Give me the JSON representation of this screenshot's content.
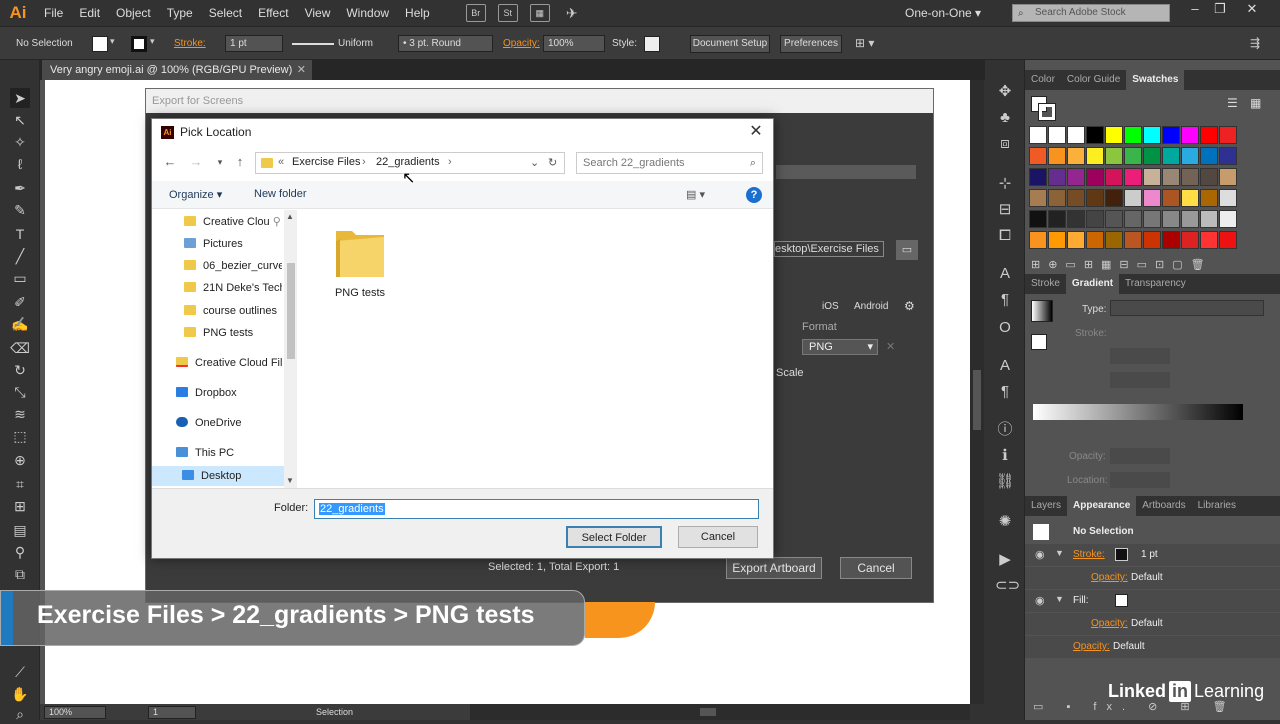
{
  "menu": {
    "logo": "Ai",
    "items": [
      "File",
      "Edit",
      "Object",
      "Type",
      "Select",
      "Effect",
      "View",
      "Window",
      "Help"
    ],
    "bridge_label": "Br",
    "stock_label": "St",
    "workspace": "One-on-One",
    "stock_search_placeholder": "Search Adobe Stock"
  },
  "control_bar": {
    "selection": "No Selection",
    "stroke_label": "Stroke:",
    "stroke_value": "1 pt",
    "profile": "Uniform",
    "brush": "3 pt. Round",
    "opacity_label": "Opacity:",
    "opacity_value": "100%",
    "style_label": "Style:",
    "document_setup": "Document Setup",
    "preferences": "Preferences"
  },
  "document": {
    "tab_title": "Very angry emoji.ai @ 100% (RGB/GPU Preview)"
  },
  "status_bar": {
    "zoom": "100%",
    "artboard": "1",
    "mode": "Selection"
  },
  "panels": {
    "top_tabs": [
      "Color",
      "Color Guide",
      "Swatches"
    ],
    "mid_tabs": [
      "Stroke",
      "Gradient",
      "Transparency"
    ],
    "gradient_type_label": "Type:",
    "gradient_stroke_label": "Stroke:",
    "opacity_label": "Opacity:",
    "location_label": "Location:",
    "bottom_tabs": [
      "Layers",
      "Appearance",
      "Artboards",
      "Libraries"
    ],
    "appearance": {
      "title": "No Selection",
      "stroke_label": "Stroke:",
      "stroke_value": "1 pt",
      "opacity_label": "Opacity:",
      "opacity_value": "Default",
      "fill_label": "Fill:",
      "fill_opacity_value": "Default",
      "global_opacity_value": "Default"
    }
  },
  "export_dialog": {
    "title": "Export for Screens",
    "path_fragment": "esktop\\Exercise Files",
    "ios_label": "iOS",
    "android_label": "Android",
    "format_header": "Format",
    "format_value": "PNG",
    "scale_label": "Scale",
    "summary": "Selected: 1, Total Export: 1",
    "export_button": "Export Artboard",
    "cancel_button": "Cancel"
  },
  "pick_location": {
    "title": "Pick Location",
    "breadcrumb_prefix": "«",
    "breadcrumb": [
      "Exercise Files",
      "22_gradients"
    ],
    "search_placeholder": "Search 22_gradients",
    "organize": "Organize ▾",
    "new_folder": "New folder",
    "help": "?",
    "nav_items": [
      "Creative Clou",
      "Pictures",
      "06_bezier_curves",
      "21N Deke's Tech",
      "course outlines",
      "PNG tests",
      "Creative Cloud Fil",
      "Dropbox",
      "OneDrive",
      "This PC",
      "Desktop"
    ],
    "folder_item": "PNG tests",
    "folder_label": "Folder:",
    "folder_value": "22_gradients",
    "select_button": "Select Folder",
    "cancel_button": "Cancel"
  },
  "overlay": {
    "caption": "Exercise Files > 22_gradients > PNG tests",
    "brand_a": "Linked",
    "brand_in": "in",
    "brand_b": "Learning"
  },
  "colors": {
    "accent_orange": "#f7931e",
    "selection_blue": "#3399ff"
  }
}
